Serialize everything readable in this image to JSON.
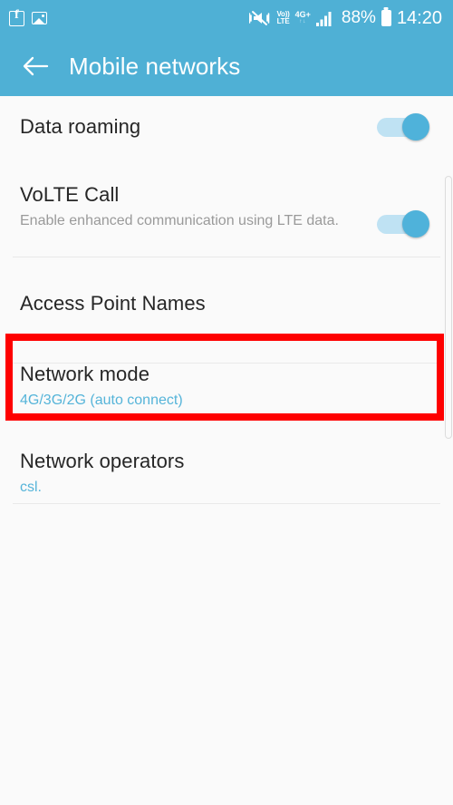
{
  "status_bar": {
    "left_icons": [
      {
        "name": "facebook-icon",
        "label": "f"
      },
      {
        "name": "screenshot-image-icon",
        "label": ""
      }
    ],
    "vibrate_icon": "vibrate-mute-icon",
    "volte": {
      "top": "Vo))",
      "bottom": "LTE"
    },
    "network_badge": {
      "top": "4G+",
      "bottom": "↑↓"
    },
    "signal_icon": "signal-bars-icon",
    "battery_percent": "88%",
    "battery_icon": "battery-full-icon",
    "clock": "14:20"
  },
  "app_bar": {
    "back_icon": "back-arrow-icon",
    "title": "Mobile networks"
  },
  "colors": {
    "header": "#4fb0d5",
    "accent": "#55b4d9",
    "highlight": "#fe0000",
    "background": "#fafafa",
    "toggle_track": "#bfe2f3",
    "toggle_knob": "#4fb2da"
  },
  "list": {
    "rows": [
      {
        "id": "data-roaming",
        "title": "Data roaming",
        "subtitle": "",
        "subtitle_style": "none",
        "control": "toggle",
        "toggle_on": true,
        "highlighted": false
      },
      {
        "id": "volte-call",
        "title": "VoLTE Call",
        "subtitle": "Enable enhanced communication using LTE data.",
        "subtitle_style": "grey",
        "control": "toggle",
        "toggle_on": true,
        "highlighted": false
      },
      {
        "id": "access-point-names",
        "title": "Access Point Names",
        "subtitle": "",
        "subtitle_style": "none",
        "control": "none",
        "toggle_on": false,
        "highlighted": false
      },
      {
        "id": "network-mode",
        "title": "Network mode",
        "subtitle": "4G/3G/2G (auto connect)",
        "subtitle_style": "blue",
        "control": "none",
        "toggle_on": false,
        "highlighted": true
      },
      {
        "id": "network-operators",
        "title": "Network operators",
        "subtitle": "csl.",
        "subtitle_style": "blue",
        "control": "none",
        "toggle_on": false,
        "highlighted": false
      }
    ]
  }
}
